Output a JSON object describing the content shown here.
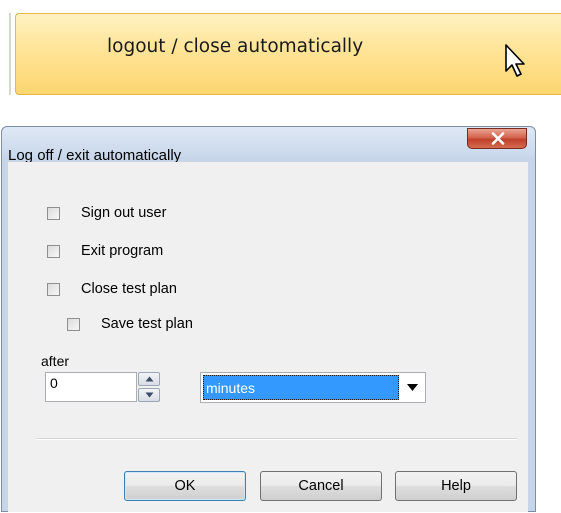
{
  "menu": {
    "item_label": "logout / close automatically",
    "highlight_color": "#ffe497",
    "cursor": "arrow-cursor-icon"
  },
  "dialog": {
    "title": "Log off / exit automatically",
    "close_icon": "x-icon",
    "close_color": "#c0412a",
    "options": [
      {
        "label": "Sign out user",
        "checked": false
      },
      {
        "label": "Exit program",
        "checked": false
      },
      {
        "label": "Close test plan",
        "checked": false
      },
      {
        "label": "Save test plan",
        "checked": false
      }
    ],
    "after_label": "after",
    "after_value": "0",
    "unit_selected": "minutes",
    "selection_color": "#3399ff",
    "buttons": {
      "ok": "OK",
      "cancel": "Cancel",
      "help": "Help"
    }
  }
}
